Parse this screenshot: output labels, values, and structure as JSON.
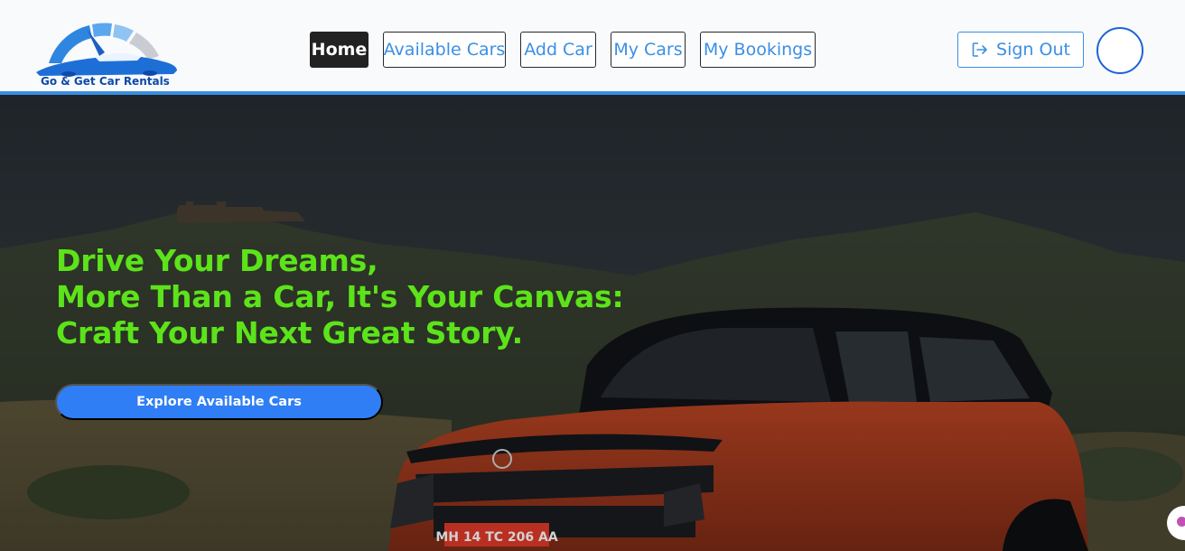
{
  "brand": {
    "name": "Go & Get Car Rentals",
    "logo_icon": "car-speedometer-logo"
  },
  "nav": {
    "items": [
      {
        "label": "Home",
        "active": true
      },
      {
        "label": "Available Cars",
        "active": false
      },
      {
        "label": "Add Car",
        "active": false
      },
      {
        "label": "My Cars",
        "active": false
      },
      {
        "label": "My Bookings",
        "active": false
      }
    ],
    "sign_out_label": "Sign Out",
    "sign_out_icon": "sign-out-icon",
    "avatar_icon": "user-avatar"
  },
  "hero": {
    "headline": [
      "Drive Your Dreams,",
      "More Than a Car, It's Your Canvas:",
      "Craft Your Next Great Story."
    ],
    "cta_label": "Explore Available Cars",
    "background": "hills-with-red-suv",
    "plate_text": "MH 14 TC 206 AA"
  },
  "colors": {
    "accent": "#3b8fe3",
    "headline": "#5ce31a",
    "cta": "#2f7ef5",
    "active_nav_bg": "#222222"
  }
}
